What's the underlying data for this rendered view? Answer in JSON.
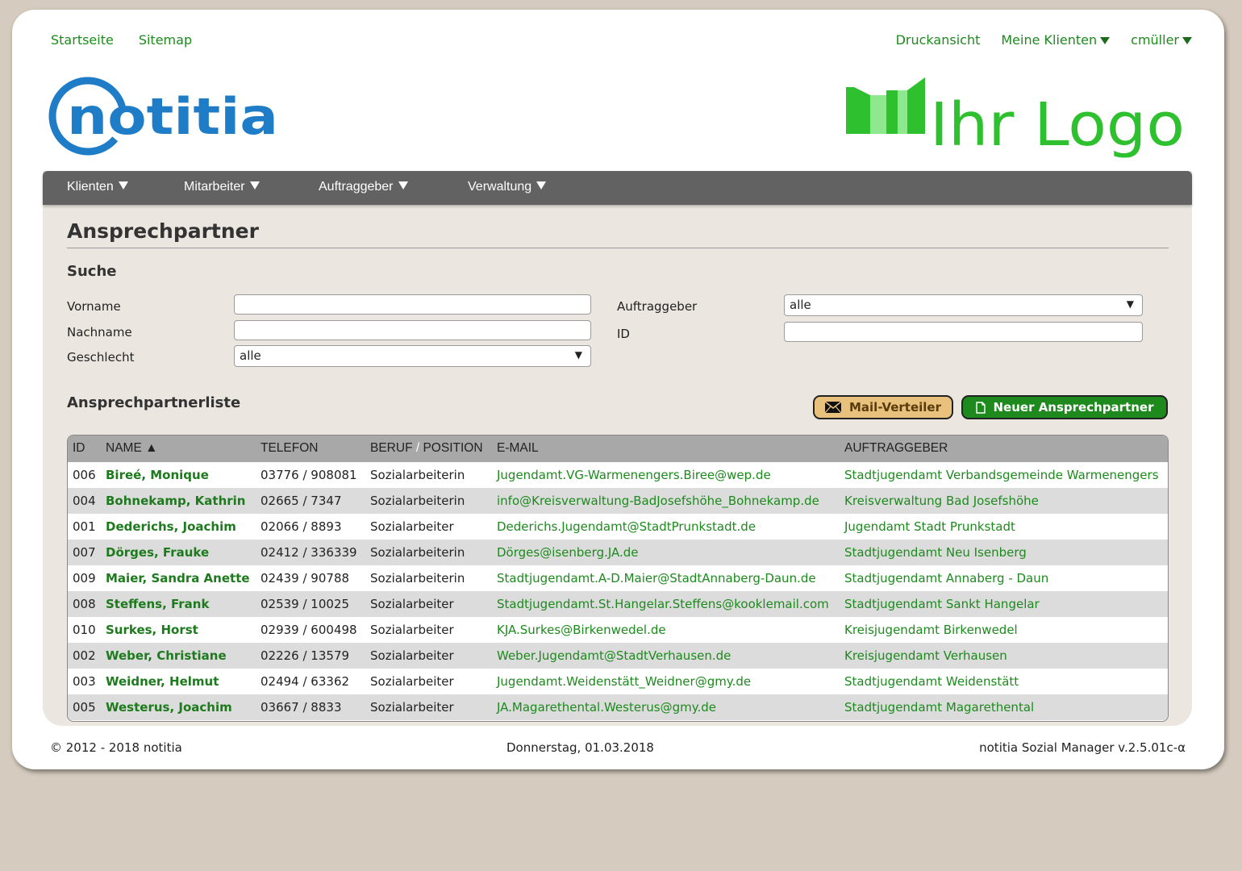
{
  "toplinks": {
    "startseite": "Startseite",
    "sitemap": "Sitemap",
    "druckansicht": "Druckansicht",
    "meine_klienten": "Meine Klienten",
    "user": "cmüller"
  },
  "logos": {
    "notitia": "notitia",
    "ihr_logo": "Ihr Logo"
  },
  "nav": {
    "items": [
      "Klienten",
      "Mitarbeiter",
      "Auftraggeber",
      "Verwaltung"
    ]
  },
  "page": {
    "title": "Ansprechpartner",
    "search_heading": "Suche",
    "list_heading": "Ansprechpartnerliste"
  },
  "search": {
    "vorname_label": "Vorname",
    "vorname_value": "",
    "nachname_label": "Nachname",
    "nachname_value": "",
    "geschlecht_label": "Geschlecht",
    "geschlecht_value": "alle",
    "auftraggeber_label": "Auftraggeber",
    "auftraggeber_value": "alle",
    "id_label": "ID",
    "id_value": ""
  },
  "buttons": {
    "mail": "Mail-Verteiler",
    "new": "Neuer Ansprechpartner"
  },
  "table": {
    "headers": {
      "id": "ID",
      "name": "NAME ▲",
      "telefon": "TELEFON",
      "beruf": "BERUF",
      "slash": " / ",
      "position": "POSITION",
      "email": "E-MAIL",
      "auftraggeber": "AUFTRAGGEBER"
    },
    "rows": [
      {
        "id": "006",
        "name": "Bireé, Monique",
        "tel": "03776 / 908081",
        "beruf": "Sozialarbeiterin",
        "email": "Jugendamt.VG-Warmenengers.Biree@wep.de",
        "auf": "Stadtjugendamt Verbandsgemeinde Warmenengers"
      },
      {
        "id": "004",
        "name": "Bohnekamp, Kathrin",
        "tel": "02665 / 7347",
        "beruf": "Sozialarbeiterin",
        "email": "info@Kreisverwaltung-BadJosefshöhe_Bohnekamp.de",
        "auf": "Kreisverwaltung Bad Josefshöhe"
      },
      {
        "id": "001",
        "name": "Dederichs, Joachim",
        "tel": "02066 / 8893",
        "beruf": "Sozialarbeiter",
        "email": "Dederichs.Jugendamt@StadtPrunkstadt.de",
        "auf": "Jugendamt Stadt Prunkstadt"
      },
      {
        "id": "007",
        "name": "Dörges, Frauke",
        "tel": "02412 / 336339",
        "beruf": "Sozialarbeiterin",
        "email": "Dörges@isenberg.JA.de",
        "auf": "Stadtjugendamt Neu Isenberg"
      },
      {
        "id": "009",
        "name": "Maier, Sandra Anette",
        "tel": "02439 / 90788",
        "beruf": "Sozialarbeiterin",
        "email": "Stadtjugendamt.A-D.Maier@StadtAnnaberg-Daun.de",
        "auf": "Stadtjugendamt Annaberg - Daun"
      },
      {
        "id": "008",
        "name": "Steffens, Frank",
        "tel": "02539 / 10025",
        "beruf": "Sozialarbeiter",
        "email": "Stadtjugendamt.St.Hangelar.Steffens@kooklemail.com",
        "auf": "Stadtjugendamt Sankt Hangelar"
      },
      {
        "id": "010",
        "name": "Surkes, Horst",
        "tel": "02939 / 600498",
        "beruf": "Sozialarbeiter",
        "email": "KJA.Surkes@Birkenwedel.de",
        "auf": "Kreisjugendamt Birkenwedel"
      },
      {
        "id": "002",
        "name": "Weber, Christiane",
        "tel": "02226 / 13579",
        "beruf": "Sozialarbeiter",
        "email": "Weber.Jugendamt@StadtVerhausen.de",
        "auf": "Kreisjugendamt Verhausen"
      },
      {
        "id": "003",
        "name": "Weidner, Helmut",
        "tel": "02494 / 63362",
        "beruf": "Sozialarbeiter",
        "email": "Jugendamt.Weidenstätt_Weidner@gmy.de",
        "auf": "Stadtjugendamt Weidenstätt"
      },
      {
        "id": "005",
        "name": "Westerus, Joachim",
        "tel": "03667 / 8833",
        "beruf": "Sozialarbeiter",
        "email": "JA.Magarethental.Westerus@gmy.de",
        "auf": "Stadtjugendamt Magarethental"
      }
    ]
  },
  "footer": {
    "copyright": "© 2012 - 2018 notitia",
    "date": "Donnerstag, 01.03.2018",
    "version": "notitia Sozial Manager v.2.5.01c-α"
  },
  "colors": {
    "link_green": "#1d8a1d",
    "notitia_blue": "#1e7dc6",
    "logo_green": "#2ec02e",
    "navbar": "#626262",
    "panel": "#ebe6e0",
    "background": "#d5cbbe"
  }
}
